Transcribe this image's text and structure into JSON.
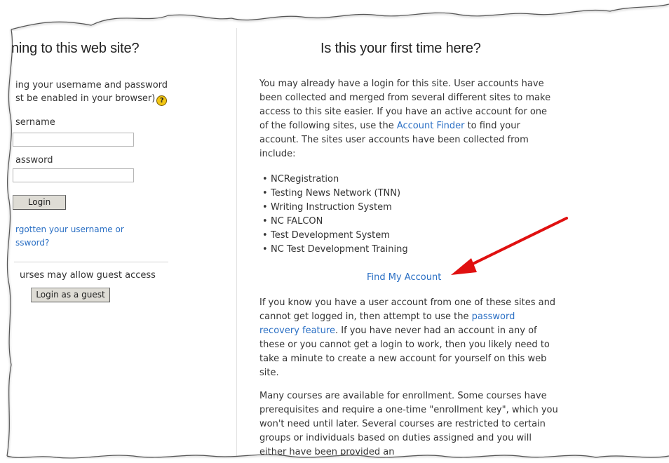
{
  "left": {
    "heading": "ning to this web site?",
    "instructions_line1": "ing your username and password",
    "instructions_line2": "st be enabled in your browser)",
    "help_icon": "help-icon",
    "username_label": "sername",
    "username_value": "",
    "password_label": "assword",
    "password_value": "",
    "login_button": "Login",
    "forgot_line1": "rgotten your username or",
    "forgot_line2": "ssword?",
    "guest_text": "urses may allow guest access",
    "guest_button": "Login as a guest"
  },
  "right": {
    "heading": "Is this your first time here?",
    "intro_before_link": "You may already have a login for this site. User accounts have been collected and merged from several different sites to make access to this site easier. If you have an active account for one of the following sites, use the ",
    "intro_link": "Account Finder",
    "intro_after_link": " to find your account. The sites user accounts have been collected from include:",
    "sites": [
      "NCRegistration",
      "Testing News Network (TNN)",
      "Writing Instruction System",
      "NC FALCON",
      "Test Development System",
      "NC Test Development Training"
    ],
    "find_link": "Find My Account",
    "recovery_before": "If you know you have a user account from one of these sites and cannot get logged in, then attempt to use the ",
    "recovery_link": "password recovery feature",
    "recovery_after": ". If you have never had an account in any of these or you cannot get a login to work, then you likely need to take a minute to create a new account for yourself on this web site.",
    "courses_text": "Many courses are available for enrollment. Some courses have prerequisites and require a one-time \"enrollment key\", which you won't need until later. Several courses are restricted to certain groups or individuals based on duties assigned and you will either have been provided an"
  },
  "colors": {
    "link": "#2a6fc4",
    "arrow": "#e01010",
    "help_icon": "#f3c713"
  }
}
